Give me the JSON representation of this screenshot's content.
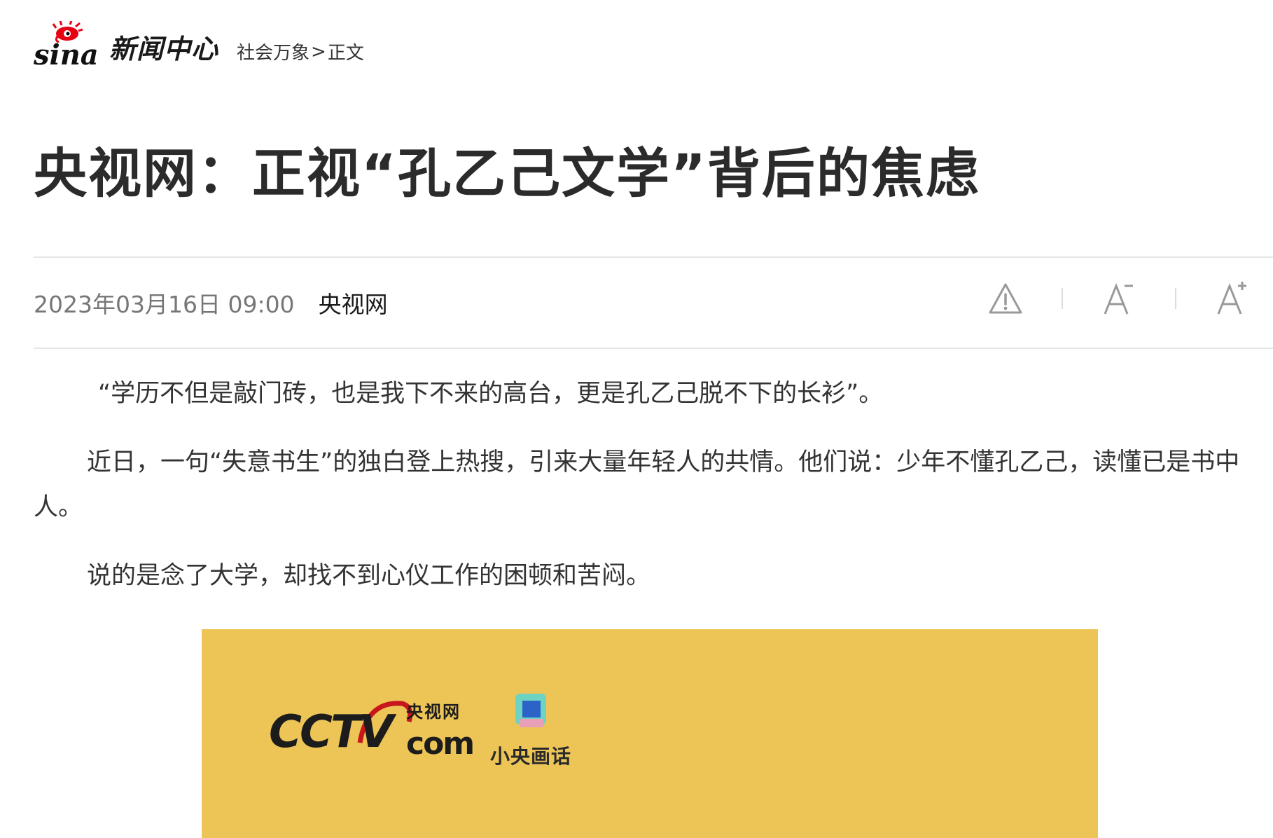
{
  "header": {
    "logo_text": "新闻中心",
    "breadcrumb": {
      "section": "社会万象",
      "separator": ">",
      "current": "正文"
    }
  },
  "article": {
    "title": "央视网：正视“孔乙己文学”背后的焦虑",
    "date": "2023年03月16日 09:00",
    "source": "央视网",
    "paragraphs": [
      "“学历不但是敲门砖，也是我下不来的高台，更是孔乙己脱不下的长衫”。",
      "近日，一句“失意书生”的独白登上热搜，引来大量年轻人的共情。他们说：少年不懂孔乙己，读懂已是书中人。",
      "说的是念了大学，却找不到心仪工作的困顿和苦闷。"
    ]
  },
  "tools": {
    "icons": [
      "warning-icon",
      "font-decrease-icon",
      "font-increase-icon"
    ]
  },
  "image": {
    "background": "#edc557",
    "cctv_text": "CCTV",
    "cctv_cn": "央视网",
    "dotcom": "com",
    "column_name": "小央画话"
  }
}
